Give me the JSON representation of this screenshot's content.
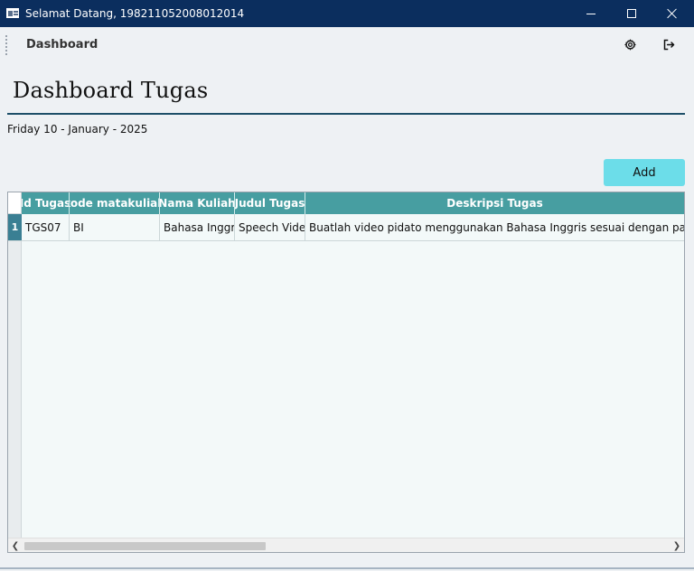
{
  "window": {
    "title": "Selamat Datang, 198211052008012014",
    "minimize_icon": "minimize-icon",
    "maximize_icon": "maximize-icon",
    "close_icon": "close-icon"
  },
  "toolbar": {
    "title": "Dashboard",
    "settings_icon": "gear-icon",
    "logout_icon": "logout-icon"
  },
  "page": {
    "title": "Dashboard Tugas",
    "date": "Friday 10 - January - 2025",
    "add_label": "Add"
  },
  "table": {
    "columns": [
      "Id Tugas",
      "kode matakuliah",
      "Nama Kuliah",
      "Judul Tugas",
      "Deskripsi Tugas"
    ],
    "rows": [
      {
        "row_number": "1",
        "cells": [
          "TGS07",
          "BI",
          "Bahasa Inggris",
          "Speech Video",
          "Buatlah video pidato menggunakan Bahasa Inggris sesuai dengan panduan yang"
        ]
      }
    ]
  },
  "colors": {
    "titlebar": "#0b2e5e",
    "header": "#479ea1",
    "add_button": "#6cdde9",
    "divider": "#1d4f68",
    "row_selector": "#3a7f93"
  }
}
